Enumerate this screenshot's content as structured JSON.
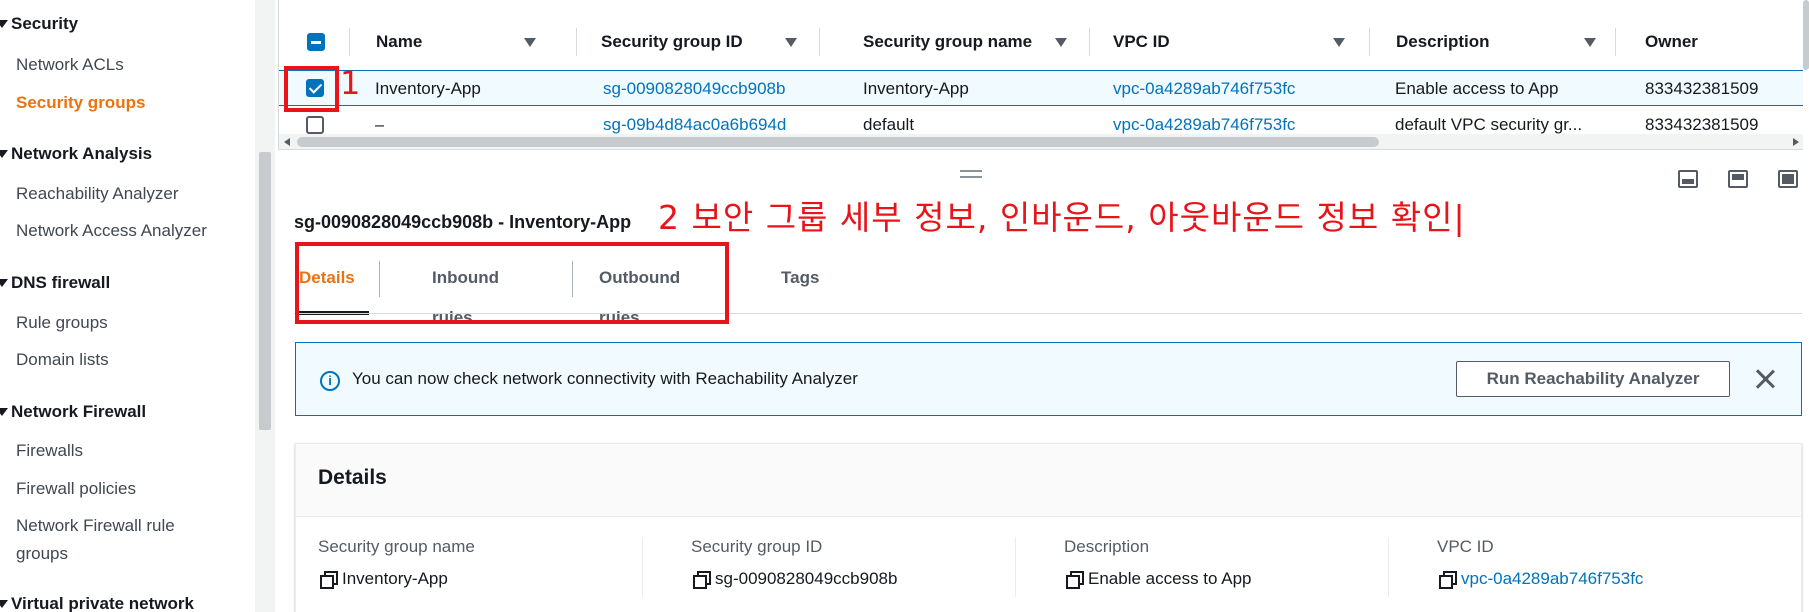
{
  "sidebar": {
    "sections": [
      {
        "title": "Security",
        "items": [
          "Network ACLs",
          "Security groups"
        ]
      },
      {
        "title": "Network Analysis",
        "items": [
          "Reachability Analyzer",
          "Network Access Analyzer"
        ]
      },
      {
        "title": "DNS firewall",
        "items": [
          "Rule groups",
          "Domain lists"
        ]
      },
      {
        "title": "Network Firewall",
        "items": [
          "Firewalls",
          "Firewall policies",
          "Network Firewall rule",
          "groups"
        ]
      },
      {
        "title": "Virtual private network",
        "items": []
      }
    ],
    "active_item": "Security groups"
  },
  "table": {
    "columns": [
      "Name",
      "Security group ID",
      "Security group name",
      "VPC ID",
      "Description",
      "Owner"
    ],
    "rows": [
      {
        "name": "Inventory-App",
        "sg_id": "sg-0090828049ccb908b",
        "sg_name": "Inventory-App",
        "vpc_id": "vpc-0a4289ab746f753fc",
        "description": "Enable access to App",
        "owner": "833432381509",
        "selected": true
      },
      {
        "name": "–",
        "sg_id": "sg-09b4d84ac0a6b694d",
        "sg_name": "default",
        "vpc_id": "vpc-0a4289ab746f753fc",
        "description": "default VPC security gr...",
        "owner": "833432381509",
        "selected": false
      }
    ]
  },
  "annotations": {
    "step1": "1",
    "step2": "2 보안 그룹 세부 정보, 인바운드, 아웃바운드 정보 확인|"
  },
  "detail": {
    "title": "sg-0090828049ccb908b - Inventory-App",
    "tabs": [
      "Details",
      "Inbound rules",
      "Outbound rules",
      "Tags"
    ],
    "active_tab": "Details"
  },
  "banner": {
    "message": "You can now check network connectivity with Reachability Analyzer",
    "button": "Run Reachability Analyzer"
  },
  "details_panel": {
    "heading": "Details",
    "fields": [
      {
        "label": "Security group name",
        "value": "Inventory-App"
      },
      {
        "label": "Security group ID",
        "value": "sg-0090828049ccb908b"
      },
      {
        "label": "Description",
        "value": "Enable access to App"
      },
      {
        "label": "VPC ID",
        "value": "vpc-0a4289ab746f753fc"
      }
    ]
  },
  "colors": {
    "accent_orange": "#ec7211",
    "link_blue": "#0073bb",
    "annotation_red": "#e8141a"
  }
}
